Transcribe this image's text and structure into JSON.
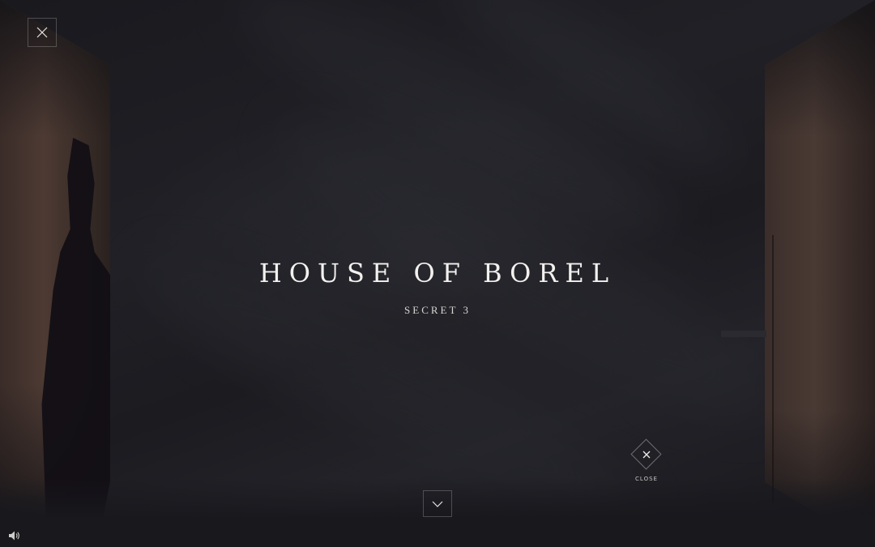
{
  "title": "HOUSE OF BOREL",
  "subtitle": "SECRET 3",
  "close_popup": {
    "label": "CLOSE",
    "icon": "close-icon"
  },
  "controls": {
    "top_close_icon": "close-icon",
    "scroll_down_icon": "chevron-down-icon",
    "sound_icon": "speaker-icon"
  },
  "colors": {
    "background": "#1c1c21",
    "text": "#f3f1ee",
    "panel": "#4a3a34"
  }
}
